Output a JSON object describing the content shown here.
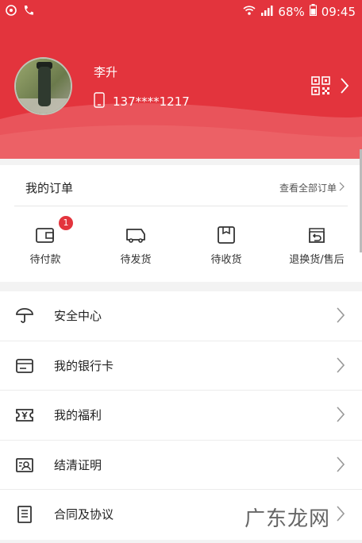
{
  "statusbar": {
    "battery": "68%",
    "time": "09:45"
  },
  "profile": {
    "name": "李升",
    "phone": "137****1217"
  },
  "orders": {
    "title": "我的订单",
    "view_all": "查看全部订单",
    "items": [
      {
        "label": "待付款",
        "badge": "1",
        "icon": "wallet-icon"
      },
      {
        "label": "待发货",
        "icon": "truck-icon"
      },
      {
        "label": "待收货",
        "icon": "package-icon"
      },
      {
        "label": "退换货/售后",
        "icon": "return-icon"
      }
    ]
  },
  "menu": [
    {
      "label": "安全中心",
      "icon": "umbrella-icon"
    },
    {
      "label": "我的银行卡",
      "icon": "card-icon"
    },
    {
      "label": "我的福利",
      "icon": "ticket-icon"
    },
    {
      "label": "结清证明",
      "icon": "certificate-icon"
    },
    {
      "label": "合同及协议",
      "icon": "document-icon"
    }
  ],
  "watermark": "广东龙网",
  "colors": {
    "brand_red": "#e3343d"
  }
}
